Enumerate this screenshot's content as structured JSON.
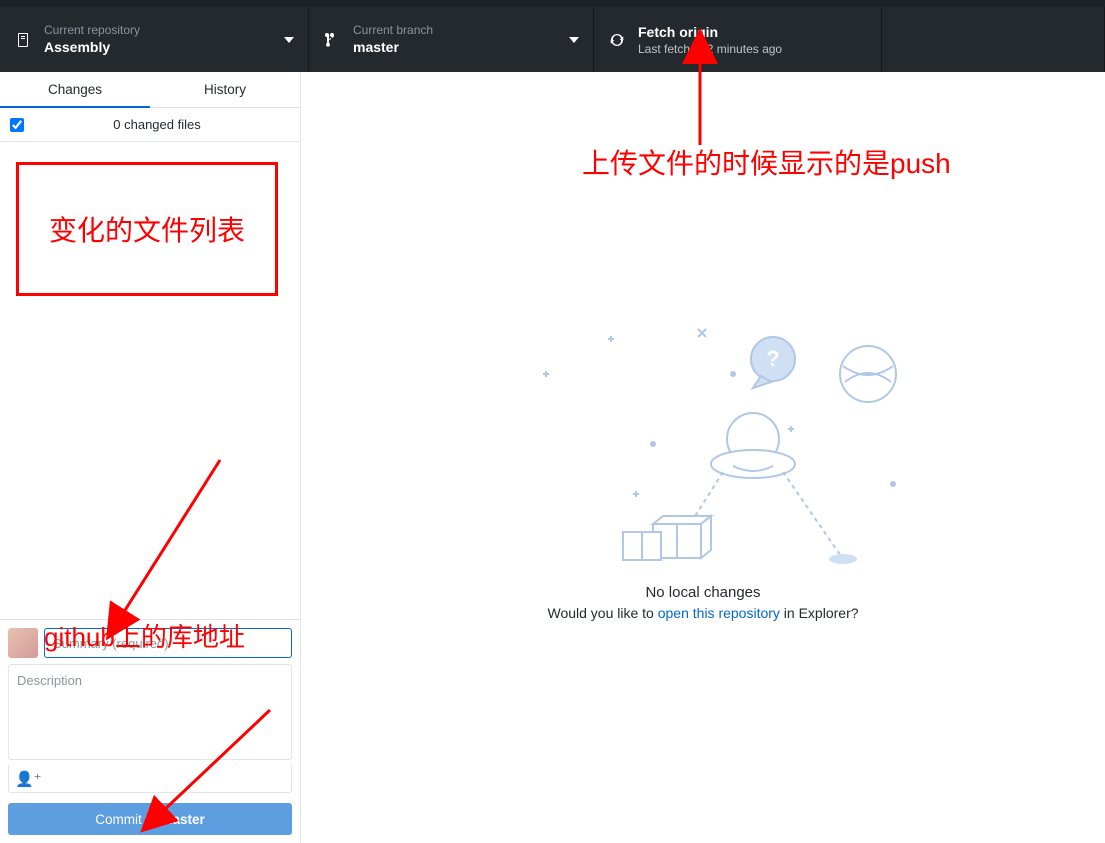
{
  "toolbar": {
    "repo": {
      "label": "Current repository",
      "value": "Assembly"
    },
    "branch": {
      "label": "Current branch",
      "value": "master"
    },
    "fetch": {
      "title": "Fetch origin",
      "subtitle": "Last fetched 2 minutes ago"
    }
  },
  "sidebar": {
    "tabs": {
      "changes": "Changes",
      "history": "History"
    },
    "files_header": "0 changed files",
    "commit": {
      "summary_placeholder": "Summary (required)",
      "description_placeholder": "Description",
      "coauthor_glyph": "👤⁺",
      "button_prefix": "Commit to ",
      "button_branch": "master"
    }
  },
  "empty_state": {
    "title": "No local changes",
    "text_before": "Would you like to ",
    "link_text": "open this repository",
    "text_after": " in Explorer?"
  },
  "annotations": {
    "box_text": "变化的文件列表",
    "summary_text": "github上的库地址",
    "push_text": "上传文件的时候显示的是push"
  }
}
